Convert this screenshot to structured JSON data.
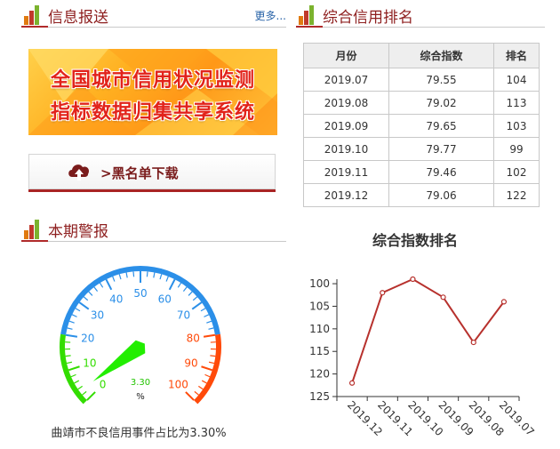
{
  "news": {
    "title": "信息报送",
    "more": "更多..."
  },
  "banner": {
    "line1": "全国城市信用状况监测",
    "line2": "指标数据归集共享系统"
  },
  "blacklist_button": {
    "label": ">黑名单下载"
  },
  "rank_section": {
    "title": "综合信用排名"
  },
  "rank_table": {
    "headers": [
      "月份",
      "综合指数",
      "排名"
    ],
    "rows": [
      [
        "2019.07",
        "79.55",
        "104"
      ],
      [
        "2019.08",
        "79.02",
        "113"
      ],
      [
        "2019.09",
        "79.65",
        "103"
      ],
      [
        "2019.10",
        "79.77",
        "99"
      ],
      [
        "2019.11",
        "79.46",
        "102"
      ],
      [
        "2019.12",
        "79.06",
        "122"
      ]
    ]
  },
  "alert_section": {
    "title": "本期警报"
  },
  "gauge": {
    "value": 3.3,
    "value_label": "3.30",
    "unit": "%",
    "min": 0,
    "max": 100,
    "tick_labels": [
      "0",
      "10",
      "20",
      "30",
      "40",
      "50",
      "60",
      "70",
      "80",
      "90",
      "100"
    ],
    "caption": "曲靖市不良信用事件占比为3.30%",
    "colors": {
      "low": "#33dd00",
      "mid": "#2b8fe8",
      "high": "#ff4a0a",
      "pointer": "#22ee00"
    }
  },
  "chart_data": {
    "type": "line",
    "title": "综合指数排名",
    "categories": [
      "2019.12",
      "2019.11",
      "2019.10",
      "2019.09",
      "2019.08",
      "2019.07"
    ],
    "values": [
      122,
      102,
      99,
      103,
      113,
      104
    ],
    "ylim": [
      125,
      99
    ],
    "yticks": [
      "100",
      "105",
      "110",
      "115",
      "120",
      "125"
    ],
    "y_inverted": true,
    "grid": false,
    "color": "#b7312d"
  },
  "colors": {
    "accent": "#8e1f1f",
    "link": "#2a64a8"
  }
}
